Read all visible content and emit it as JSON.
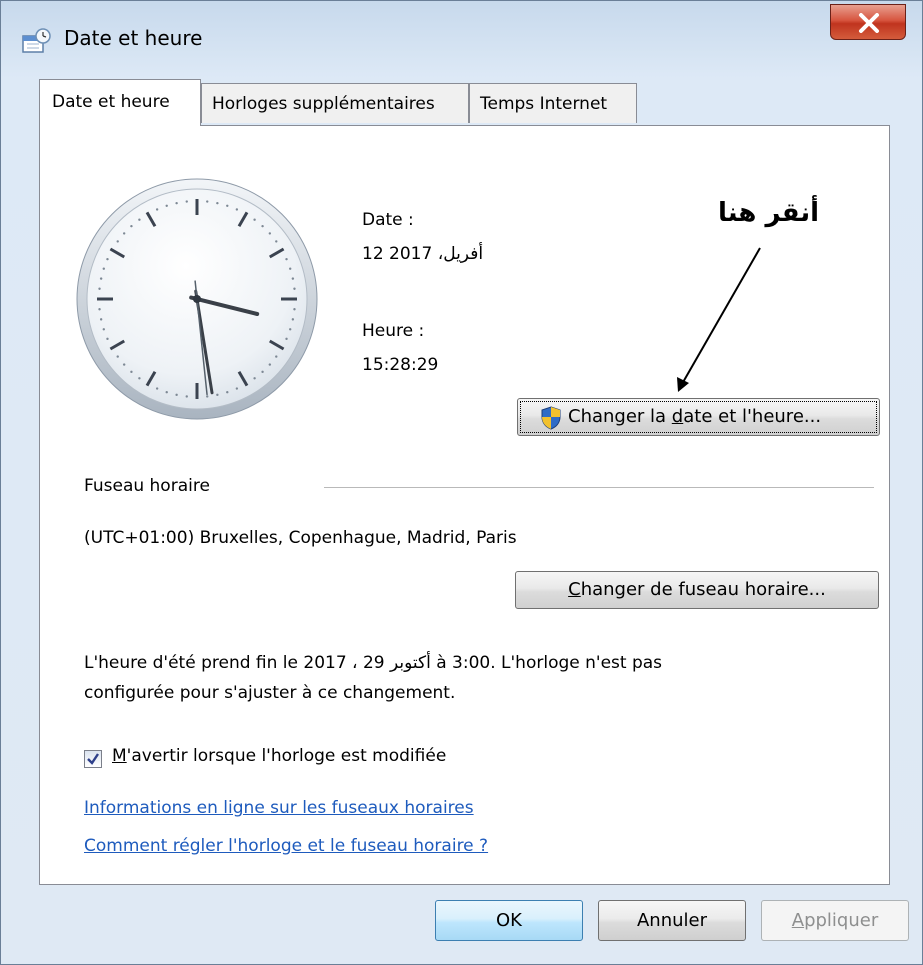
{
  "window": {
    "title": "Date et heure",
    "close_symbol": "X"
  },
  "tabs": [
    {
      "label": "Date et heure",
      "active": true
    },
    {
      "label": "Horloges supplémentaires",
      "active": false
    },
    {
      "label": "Temps Internet",
      "active": false
    }
  ],
  "clock": {
    "hour": 15,
    "minute": 28,
    "second": 29
  },
  "date_time": {
    "date_label": "Date :",
    "date_value": "12 أفريل، 2017",
    "time_label": "Heure :",
    "time_value": "15:28:29",
    "change_button": {
      "pre": "Changer la ",
      "accel": "d",
      "post": "ate et l'heure..."
    }
  },
  "annotation": {
    "text": "أنقر هنا"
  },
  "timezone": {
    "section_label": "Fuseau horaire",
    "value": "(UTC+01:00) Bruxelles, Copenhague, Madrid, Paris",
    "change_button": {
      "accel": "C",
      "post": "hanger de fuseau horaire..."
    }
  },
  "dst_notice": {
    "line1": "L'heure d'été prend fin le 2017 ، 29 أكتوبر à 3:00. L'horloge n'est pas",
    "line2": "configurée pour s'ajuster à ce changement."
  },
  "notify": {
    "checked": true,
    "accel": "M",
    "post": "'avertir lorsque l'horloge est modifiée"
  },
  "links": [
    "Informations en ligne sur les fuseaux horaires",
    "Comment régler l'horloge et le fuseau horaire ?"
  ],
  "footer": {
    "ok": "OK",
    "cancel": "Annuler",
    "apply_accel": "A",
    "apply_post": "ppliquer"
  },
  "colors": {
    "link": "#1e5bbd",
    "close_button": "#c0341e"
  },
  "icons": {
    "title": "clock-calendar-icon",
    "shield": "uac-shield-icon",
    "close": "close-icon",
    "checkbox": "checkmark-icon"
  }
}
